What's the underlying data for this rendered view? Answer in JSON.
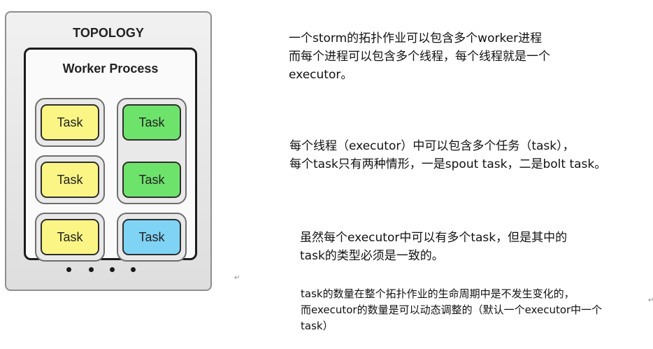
{
  "diagram": {
    "topology_title": "TOPOLOGY",
    "worker_title": "Worker Process",
    "tasks": [
      {
        "label": "Task",
        "color": "#fbf585"
      },
      {
        "label": "Task",
        "color": "#6ee36c"
      },
      {
        "label": "Task",
        "color": "#fbf585"
      },
      {
        "label": "Task",
        "color": "#6ee36c"
      },
      {
        "label": "Task",
        "color": "#fbf585"
      },
      {
        "label": "Task",
        "color": "#7fd3f5"
      }
    ]
  },
  "notes": [
    "一个storm的拓扑作业可以包含多个worker进程\n而每个进程可以包含多个线程，每个线程就是一个\nexecutor。",
    "每个线程（executor）中可以包含多个任务（task），\n每个task只有两种情形，一是spout task，二是bolt task。",
    "虽然每个executor中可以有多个task，但是其中的\ntask的类型必须是一致的。",
    "task的数量在整个拓扑作业的生命周期中是不发生变化的，\n而executor的数量是可以动态调整的（默认一个executor中一个\ntask）"
  ]
}
